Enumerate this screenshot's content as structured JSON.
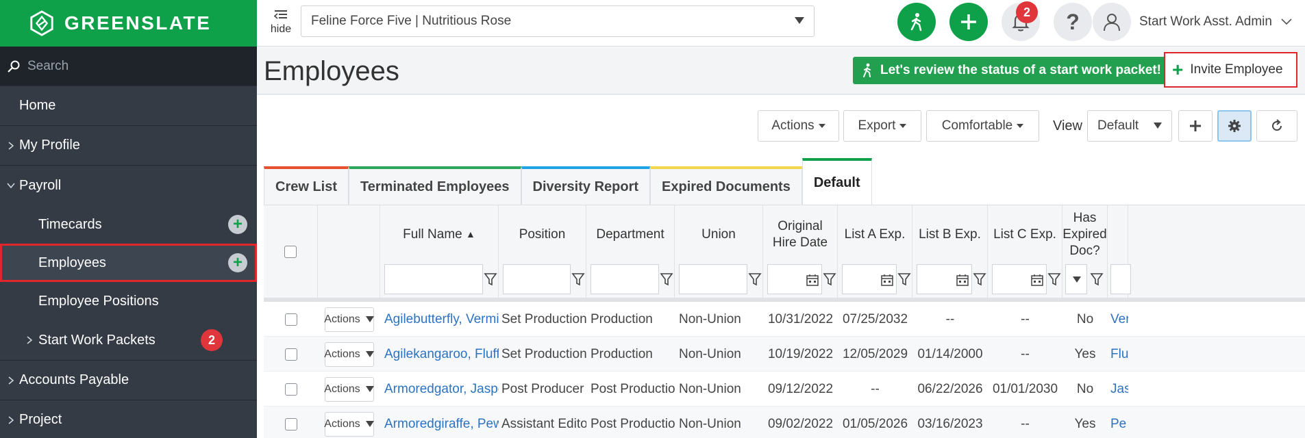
{
  "brand": {
    "name": "GREENSLATE",
    "color": "#0fa14a"
  },
  "search": {
    "placeholder": "Search"
  },
  "sidebar": {
    "items": [
      {
        "label": "Home"
      },
      {
        "label": "My Profile"
      },
      {
        "label": "Payroll"
      },
      {
        "label": "Timecards"
      },
      {
        "label": "Employees"
      },
      {
        "label": "Employee Positions"
      },
      {
        "label": "Start Work Packets",
        "badge": "2"
      },
      {
        "label": "Accounts Payable"
      },
      {
        "label": "Project"
      }
    ]
  },
  "header": {
    "hide_label": "hide",
    "project_select": "Feline Force Five | Nutritious Rose",
    "notification_count": "2",
    "help_label": "?",
    "user_name": "Start Work Asst. Admin"
  },
  "page": {
    "title": "Employees",
    "review_button": "Let's review the status of a start work packet!",
    "invite_button": "Invite Employee"
  },
  "toolbar": {
    "actions": "Actions",
    "export": "Export",
    "density": "Comfortable",
    "view_label": "View",
    "view_value": "Default"
  },
  "tabs": [
    {
      "label": "Crew List",
      "color": "#e8512e"
    },
    {
      "label": "Terminated Employees",
      "color": "#2aa757"
    },
    {
      "label": "Diversity Report",
      "color": "#1ea4e4"
    },
    {
      "label": "Expired Documents",
      "color": "#f2d64b"
    },
    {
      "label": "Default",
      "color": "#0fa14a"
    }
  ],
  "table": {
    "columns": [
      "Full Name",
      "Position",
      "Department",
      "Union",
      "Original Hire Date",
      "List A Exp.",
      "List B Exp.",
      "List C Exp.",
      "Has Expired Doc?"
    ],
    "sort_indicator": "▲",
    "row_action_label": "Actions",
    "rows": [
      {
        "name": "Agilebutterfly, Vermil...",
        "position": "Set Production...",
        "department": "Production",
        "union": "Non-Union",
        "hire": "10/31/2022",
        "a": "07/25/2032",
        "b": "--",
        "c": "--",
        "expired": "No",
        "extra": "Ver"
      },
      {
        "name": "Agilekangaroo, Fluffy",
        "position": "Set Production...",
        "department": "Production",
        "union": "Non-Union",
        "hire": "10/19/2022",
        "a": "12/05/2029",
        "b": "01/14/2000",
        "c": "--",
        "expired": "Yes",
        "extra": "Flu"
      },
      {
        "name": "Armoredgator, Jasper",
        "position": "Post Producer",
        "department": "Post Production",
        "union": "Non-Union",
        "hire": "09/12/2022",
        "a": "--",
        "b": "06/22/2026",
        "c": "01/01/2030",
        "expired": "No",
        "extra": "Jas"
      },
      {
        "name": "Armoredgiraffe, Pew...",
        "position": "Assistant Editor",
        "department": "Post Production",
        "union": "Non-Union",
        "hire": "09/02/2022",
        "a": "01/05/2026",
        "b": "03/16/2023",
        "c": "--",
        "expired": "Yes",
        "extra": "Pe"
      }
    ]
  }
}
